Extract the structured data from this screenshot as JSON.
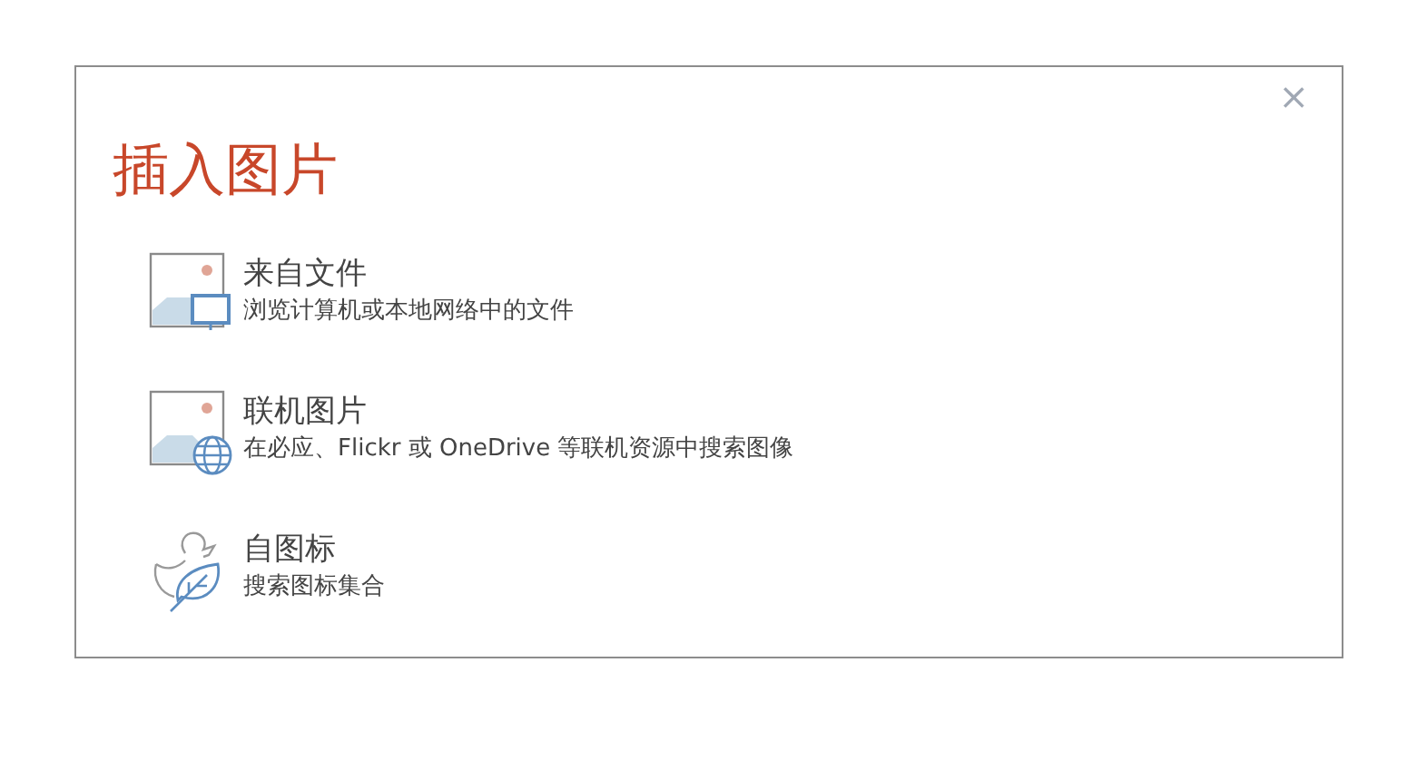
{
  "dialog": {
    "title": "插入图片",
    "close": "×"
  },
  "options": [
    {
      "kind": "file",
      "title": "来自文件",
      "description": "浏览计算机或本地网络中的文件"
    },
    {
      "kind": "online",
      "title": "联机图片",
      "description": "在必应、Flickr 或 OneDrive 等联机资源中搜索图像"
    },
    {
      "kind": "icons",
      "title": "自图标",
      "description": "搜索图标集合"
    }
  ]
}
